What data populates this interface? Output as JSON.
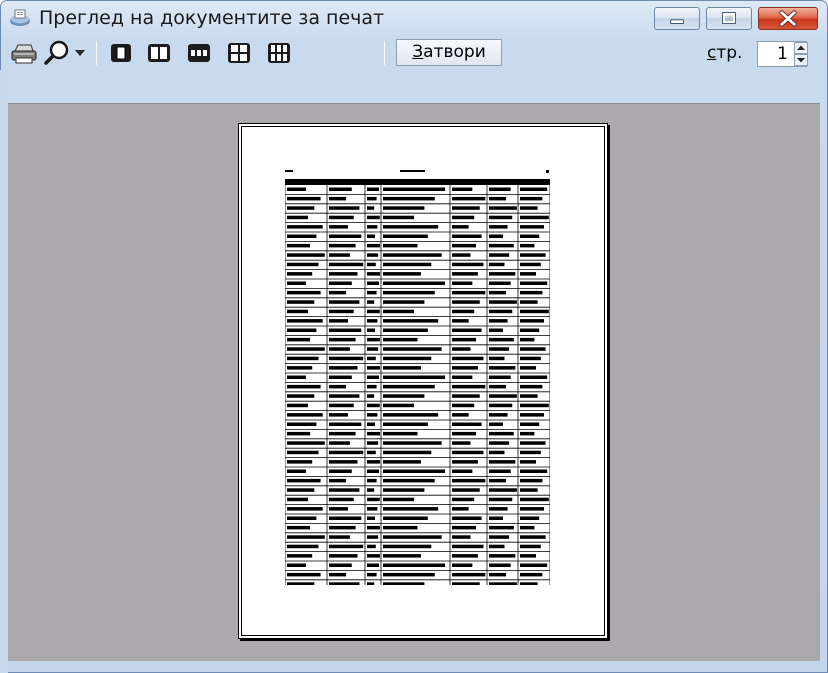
{
  "window": {
    "title": "Преглед на документите за печат",
    "icon": "printer-preview-icon"
  },
  "caption_buttons": {
    "minimize": "minimize-icon",
    "maximize": "maximize-icon",
    "close": "close-icon"
  },
  "toolbar": {
    "print_icon": "printer-icon",
    "zoom_icon": "magnifier-icon",
    "zoom_dropdown_icon": "chevron-down-icon",
    "view_buttons": [
      "one-page-icon",
      "two-pages-icon",
      "three-pages-icon",
      "four-pages-icon",
      "six-pages-icon"
    ],
    "close_label_underlined": "З",
    "close_label_rest": "атвори",
    "page_label_underlined": "с",
    "page_label_rest": "тр.",
    "page_value": "1"
  },
  "colors": {
    "preview_background": "#aba9ab",
    "close_button_red": "#c8391c"
  }
}
